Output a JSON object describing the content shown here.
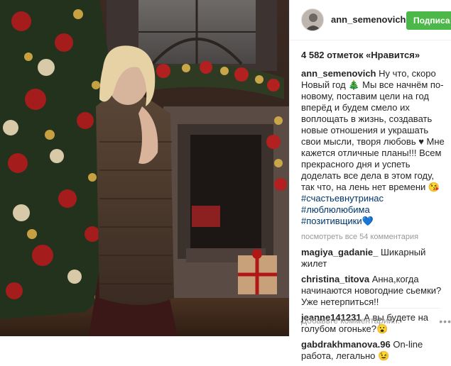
{
  "post": {
    "username": "ann_semenovich",
    "follow_label": "Подписа",
    "likes_text": "4 582 отметок «Нравится»",
    "caption_user": "ann_semenovich",
    "caption_text_1": " Ну что, скоро Новый год 🎄 Мы все начнём по-новому, поставим цели на год вперёд и будем смело их воплощать в жизнь, создавать новые отношения и украшать свои мысли, творя любовь ",
    "caption_heart": "♥",
    "caption_text_2": " Мне кажется отличные планы!!! Всем прекрасного дня и успеть доделать все дела в этом году, так что, на лень нет времени 😘",
    "hashtags": [
      "#счастьевнутринас",
      "#люблюлюбима",
      "#позитивщики"
    ],
    "hashtag_heart": "💙",
    "view_all_comments": "посмотреть все 54 комментария",
    "comments": [
      {
        "user": "magiya_gadanie_",
        "text": " Шикарный жилет"
      },
      {
        "user": "christina_titova",
        "text": " Анна,когда начинаются новогодние сьемки? Уже нетерпиться!!"
      },
      {
        "user": "jeanne141231",
        "text": " А вы будете на голубом огоньке?😮"
      },
      {
        "user": "gabdrakhmanova.96",
        "text": " On-line работа, легально 😉"
      }
    ],
    "add_comment_placeholder": "Добавьте комментарий...",
    "more_icon_text": "•••"
  },
  "icons": {
    "avatar": "user-avatar",
    "more": "more-options-icon"
  }
}
